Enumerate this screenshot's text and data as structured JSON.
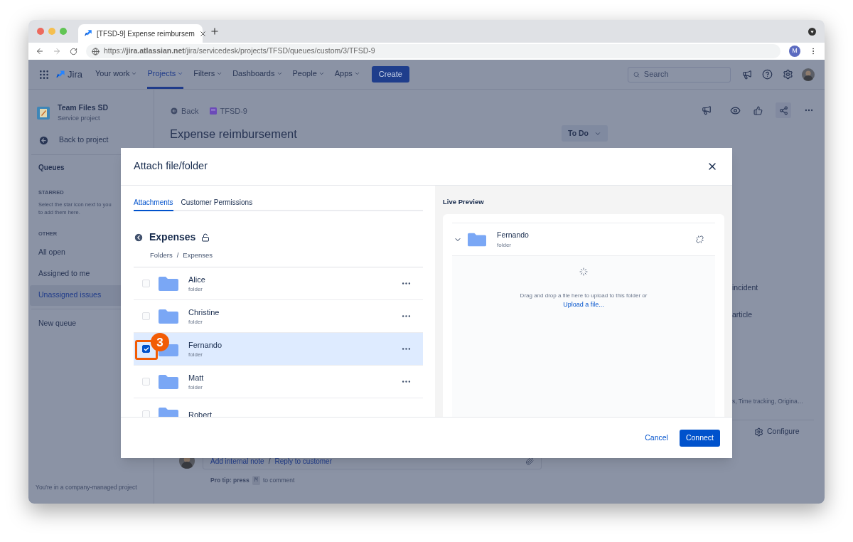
{
  "browser": {
    "tab_title": "[TFSD-9] Expense reimbursem",
    "url": "https://**jira.atlassian.net**/jira/servicedesk/projects/TFSD/queues/custom/3/TFSD-9",
    "profile_initial": "M"
  },
  "nav": {
    "product": "Jira",
    "items": [
      {
        "label": "Your work",
        "selected": false
      },
      {
        "label": "Projects",
        "selected": true
      },
      {
        "label": "Filters",
        "selected": false
      },
      {
        "label": "Dashboards",
        "selected": false
      },
      {
        "label": "People",
        "selected": false
      },
      {
        "label": "Apps",
        "selected": false
      }
    ],
    "create": "Create",
    "search_placeholder": "Search"
  },
  "sidebar": {
    "project_name": "Team Files SD",
    "project_type": "Service project",
    "back": "Back to project",
    "queues": "Queues",
    "starred_heading": "STARRED",
    "starred_hint": [
      "Select the star icon next to you",
      "to add them here."
    ],
    "other_heading": "OTHER",
    "queue_items": [
      {
        "label": "All open",
        "selected": false
      },
      {
        "label": "Assigned to me",
        "selected": false
      },
      {
        "label": "Unassigned issues",
        "selected": true
      }
    ],
    "new_queue": "New queue",
    "footer": "You're in a company-managed project"
  },
  "issue": {
    "back": "Back",
    "key": "TFSD-9",
    "title": "Expense reimbursement",
    "status": "To Do",
    "side_texts": [
      "incident",
      "article"
    ],
    "fields_summary": "s, Time tracking, Origina…",
    "configure": "Configure",
    "comment": {
      "add_note": "Add internal note",
      "separator": "/",
      "reply": "Reply to customer"
    },
    "pro_tip": {
      "prefix": "Pro tip: press",
      "key": "M",
      "suffix": "to comment"
    }
  },
  "modal": {
    "title": "Attach file/folder",
    "tabs": [
      {
        "label": "Attachments",
        "selected": true
      },
      {
        "label": "Customer Permissions",
        "selected": false
      }
    ],
    "folder": {
      "name": "Expenses",
      "breadcrumb": [
        "Folders",
        "Expenses"
      ],
      "separator": "/"
    },
    "rows": [
      {
        "name": "Alice",
        "subtitle": "folder",
        "checked": false,
        "selected": false
      },
      {
        "name": "Christine",
        "subtitle": "folder",
        "checked": false,
        "selected": false
      },
      {
        "name": "Fernando",
        "subtitle": "folder",
        "checked": true,
        "selected": true,
        "callout": "3"
      },
      {
        "name": "Matt",
        "subtitle": "folder",
        "checked": false,
        "selected": false
      },
      {
        "name": "Robert",
        "checked": false,
        "selected": false
      }
    ],
    "preview": {
      "heading": "Live Preview",
      "item": {
        "name": "Fernando",
        "subtitle": "folder"
      },
      "drop_text": "Drag and drop a file here to upload to this folder or",
      "upload_link": "Upload a file..."
    },
    "cancel": "Cancel",
    "connect": "Connect"
  }
}
